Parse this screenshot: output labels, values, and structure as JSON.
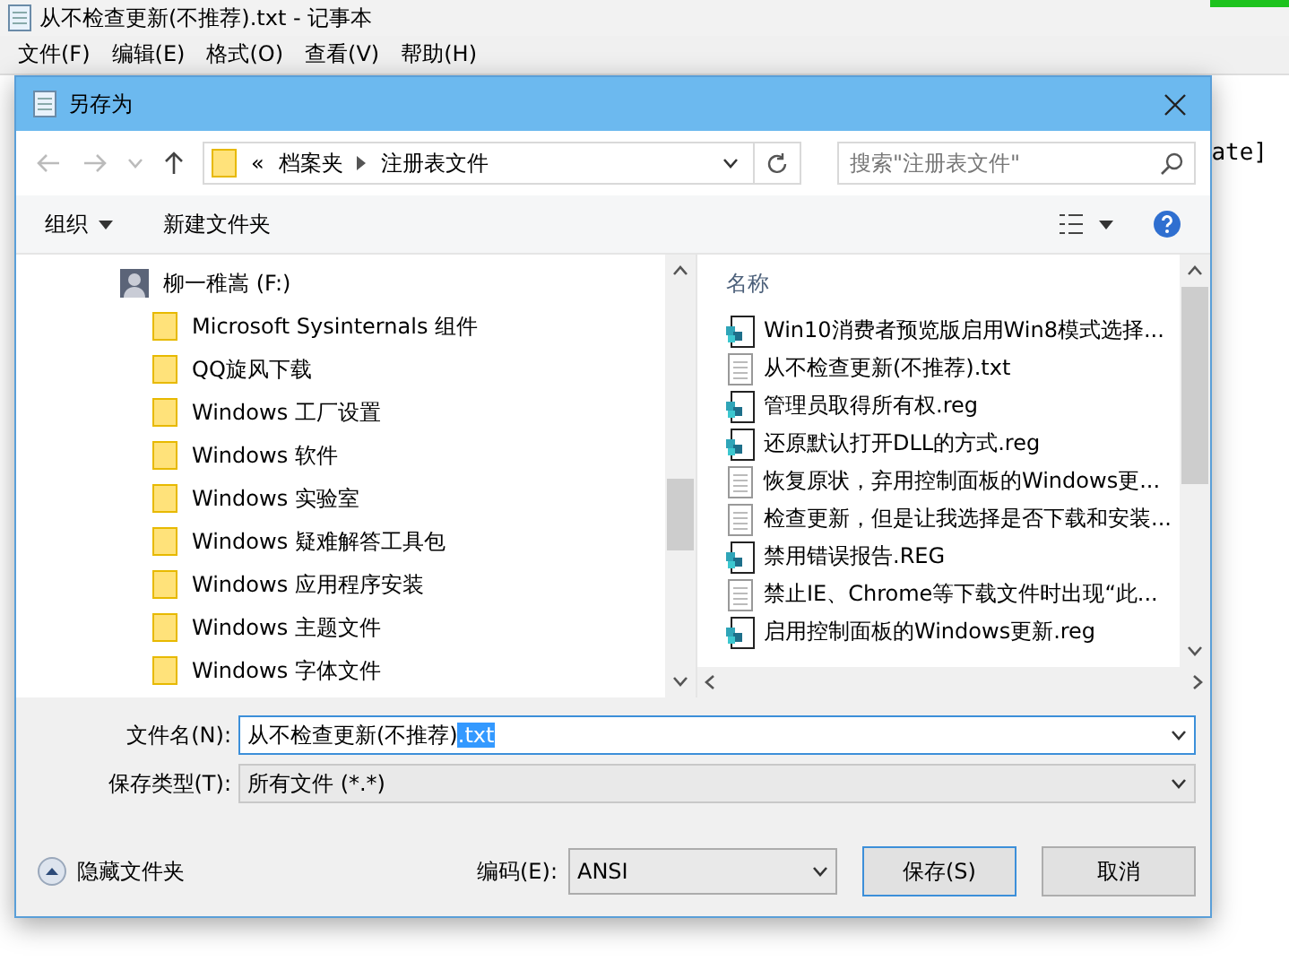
{
  "notepad": {
    "title": "从不检查更新(不推荐).txt - 记事本",
    "menu": [
      "文件(F)",
      "编辑(E)",
      "格式(O)",
      "查看(V)",
      "帮助(H)"
    ],
    "body_text": "ate]"
  },
  "dialog": {
    "title": "另存为",
    "address": {
      "path": [
        "«",
        "档案夹",
        "注册表文件"
      ],
      "search_placeholder": "搜索\"注册表文件\""
    },
    "toolbar": {
      "organize": "组织",
      "new_folder": "新建文件夹"
    },
    "tree": {
      "drive": "柳一稚嵩 (F:)",
      "folders": [
        "Microsoft Sysinternals 组件",
        "QQ旋风下载",
        "Windows 工厂设置",
        "Windows 软件",
        "Windows 实验室",
        "Windows 疑难解答工具包",
        "Windows 应用程序安装",
        "Windows 主题文件",
        "Windows 字体文件"
      ]
    },
    "files": {
      "column": "名称",
      "items": [
        {
          "name": "Win10消费者预览版启用Win8模式选择...",
          "kind": "reg"
        },
        {
          "name": "从不检查更新(不推荐).txt",
          "kind": "txt"
        },
        {
          "name": "管理员取得所有权.reg",
          "kind": "reg"
        },
        {
          "name": "还原默认打开DLL的方式.reg",
          "kind": "reg"
        },
        {
          "name": "恢复原状，弃用控制面板的Windows更...",
          "kind": "txt"
        },
        {
          "name": "检查更新，但是让我选择是否下载和安装...",
          "kind": "txt"
        },
        {
          "name": "禁用错误报告.REG",
          "kind": "reg"
        },
        {
          "name": "禁止IE、Chrome等下载文件时出现“此...",
          "kind": "txt"
        },
        {
          "name": "启用控制面板的Windows更新.reg",
          "kind": "reg"
        }
      ]
    },
    "filename": {
      "label": "文件名(N):",
      "value": "从不检查更新(不推荐)",
      "selected_part": ".txt"
    },
    "filetype": {
      "label": "保存类型(T):",
      "value": "所有文件  (*.*)"
    },
    "hide_folders": "隐藏文件夹",
    "encoding": {
      "label": "编码(E):",
      "value": "ANSI"
    },
    "buttons": [
      "保存(S)",
      "取消"
    ]
  }
}
